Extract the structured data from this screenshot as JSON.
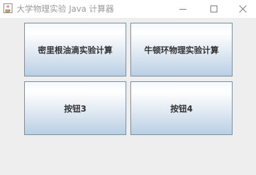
{
  "window": {
    "title": "大学物理实验 Java 计算器",
    "icon": "java-cup-icon",
    "controls": {
      "minimize": "minimize-icon",
      "maximize": "maximize-icon",
      "close": "close-icon"
    }
  },
  "buttons": [
    {
      "label": "密里根油滴实验计算"
    },
    {
      "label": "牛顿环物理实验计算"
    },
    {
      "label": "按钮3"
    },
    {
      "label": "按钮4"
    }
  ],
  "colors": {
    "background": "#eeeeee",
    "titlebar": "#ffffff",
    "title_text": "#9a9a9a",
    "button_border": "#7a8a99",
    "button_gradient_bottom": "#b8cfe4",
    "button_text": "#333333"
  }
}
